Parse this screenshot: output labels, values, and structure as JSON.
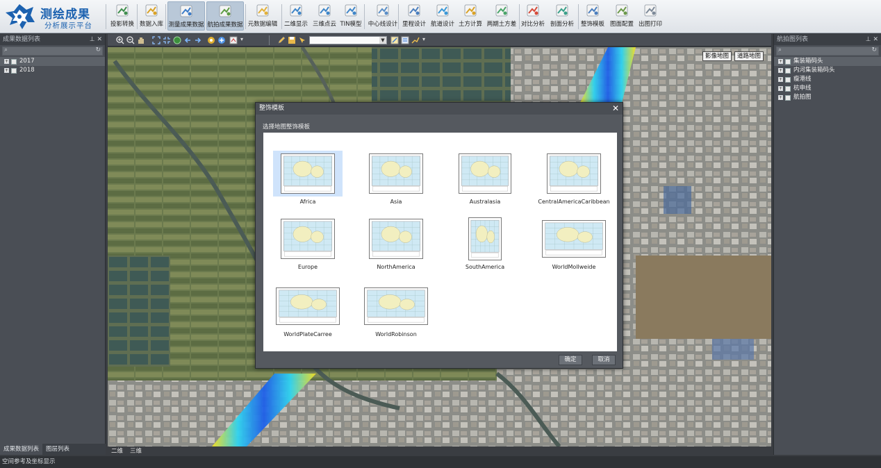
{
  "app": {
    "title_line1": "测绘成果",
    "title_line2": "分析展示平台"
  },
  "toolbar": {
    "items": [
      {
        "label": "投影转换",
        "icon": "projection-icon"
      },
      {
        "label": "数据入库",
        "icon": "database-icon"
      },
      {
        "label": "测量成果数据",
        "icon": "survey-data-icon",
        "active": true
      },
      {
        "label": "航拍成果数据",
        "icon": "aerial-data-icon",
        "active": true
      },
      {
        "label": "元数据编辑",
        "icon": "edit-icon"
      },
      {
        "label": "二维显示",
        "icon": "2d-view-icon"
      },
      {
        "label": "三维点云",
        "icon": "point-cloud-icon"
      },
      {
        "label": "TIN模型",
        "icon": "tin-icon"
      },
      {
        "label": "中心线设计",
        "icon": "centerline-icon"
      },
      {
        "label": "里程设计",
        "icon": "mileage-icon"
      },
      {
        "label": "航道设计",
        "icon": "channel-icon"
      },
      {
        "label": "土方计算",
        "icon": "earthwork-icon"
      },
      {
        "label": "两期土方差",
        "icon": "earthwork-diff-icon"
      },
      {
        "label": "对比分析",
        "icon": "compare-icon"
      },
      {
        "label": "剖面分析",
        "icon": "profile-icon"
      },
      {
        "label": "整饰模板",
        "icon": "template-icon"
      },
      {
        "label": "图面配置",
        "icon": "map-config-icon"
      },
      {
        "label": "出图打印",
        "icon": "print-icon"
      }
    ]
  },
  "left_panel": {
    "title": "成果数据列表",
    "tree": [
      "2017",
      "2018"
    ],
    "tabs": [
      "成果数据列表",
      "图层列表"
    ]
  },
  "right_panel": {
    "title": "航拍图列表",
    "tree": [
      "集装箱码头",
      "内河集装箱码头",
      "瘦港线",
      "杭申线",
      "航拍图"
    ]
  },
  "map": {
    "mode_buttons": [
      "影像地图",
      "道路地图"
    ],
    "view_tabs": [
      "二维",
      "三维"
    ]
  },
  "status_bar": {
    "text": "空间参考及坐标显示"
  },
  "modal": {
    "title": "整饰模板",
    "subtitle": "选择地图整饰模板",
    "templates": [
      {
        "name": "Africa",
        "selected": true
      },
      {
        "name": "Asia"
      },
      {
        "name": "Australasia"
      },
      {
        "name": "CentralAmericaCaribbean"
      },
      {
        "name": "Europe"
      },
      {
        "name": "NorthAmerica"
      },
      {
        "name": "SouthAmerica"
      },
      {
        "name": "WorldMollweide"
      },
      {
        "name": "WorldPlateCarree"
      },
      {
        "name": "WorldRobinson"
      }
    ],
    "ok_label": "确定",
    "cancel_label": "取消"
  },
  "colors": {
    "accent": "#1c62b0",
    "panel": "#4a4e55",
    "modal": "#55595f"
  }
}
